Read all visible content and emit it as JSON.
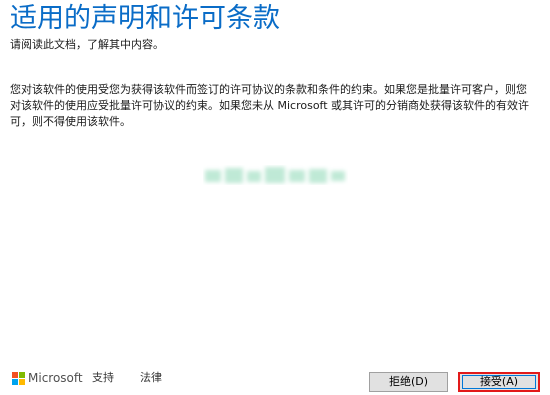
{
  "header": {
    "title": "适用的声明和许可条款",
    "subtitle": "请阅读此文档，了解其中内容。"
  },
  "body": {
    "lines": [
      "您对该软件的使用受您为获得该软件而签订的许可协议的条款和条件的约束。如果您是批量许可客户，则您",
      "对该软件的使用应受批量许可协议的约束。如果您未从 Microsoft 或其许可的分销商处获得该软件的有效许",
      "可，则不得使用该软件。"
    ]
  },
  "footer": {
    "brand": "Microsoft",
    "support_label": "支持",
    "legal_label": "法律"
  },
  "buttons": {
    "decline_label": "拒绝(D)",
    "accept_label": "接受(A)"
  },
  "colors": {
    "title": "#0a6cc7",
    "accept_highlight": "#e21a1a",
    "logo": [
      "#f25022",
      "#7fba00",
      "#00a4ef",
      "#ffb900"
    ]
  }
}
